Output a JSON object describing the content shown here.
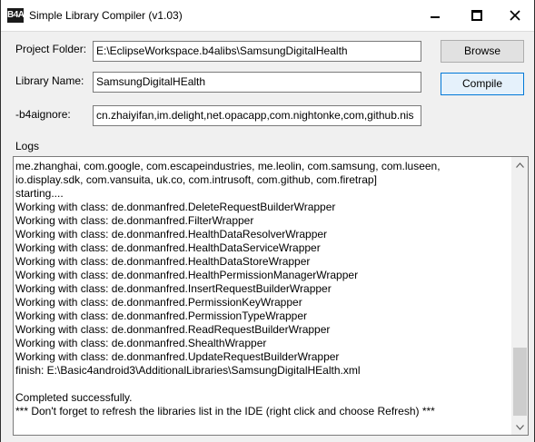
{
  "window": {
    "app_icon": "B4A",
    "title": "Simple Library Compiler (v1.03)",
    "controls": {
      "minimize_icon": "minimize-icon",
      "maximize_icon": "maximize-icon",
      "close_icon": "close-icon"
    }
  },
  "form": {
    "project_folder_label": "Project Folder:",
    "project_folder_value": "E:\\EclipseWorkspace.b4alibs\\SamsungDigitalHealth",
    "library_name_label": "Library Name:",
    "library_name_value": "SamsungDigitalHEalth",
    "b4aignore_label": "-b4aignore:",
    "b4aignore_value": "cn.zhaiyifan,im.delight,net.opacapp,com.nightonke,com,github.nis",
    "browse_label": "Browse",
    "compile_label": "Compile"
  },
  "logs": {
    "label": "Logs",
    "lines": [
      "me.zhanghai, com.google, com.escapeindustries, me.leolin, com.samsung, com.luseen,",
      "io.display.sdk, com.vansuita, uk.co, com.intrusoft, com.github, com.firetrap]",
      "starting....",
      "Working with class: de.donmanfred.DeleteRequestBuilderWrapper",
      "Working with class: de.donmanfred.FilterWrapper",
      "Working with class: de.donmanfred.HealthDataResolverWrapper",
      "Working with class: de.donmanfred.HealthDataServiceWrapper",
      "Working with class: de.donmanfred.HealthDataStoreWrapper",
      "Working with class: de.donmanfred.HealthPermissionManagerWrapper",
      "Working with class: de.donmanfred.InsertRequestBuilderWrapper",
      "Working with class: de.donmanfred.PermissionKeyWrapper",
      "Working with class: de.donmanfred.PermissionTypeWrapper",
      "Working with class: de.donmanfred.ReadRequestBuilderWrapper",
      "Working with class: de.donmanfred.ShealthWrapper",
      "Working with class: de.donmanfred.UpdateRequestBuilderWrapper",
      "finish: E:\\Basic4android3\\AdditionalLibraries\\SamsungDigitalHEalth.xml",
      "",
      "Completed successfully.",
      "*** Don't forget to refresh the libraries list in the IDE (right click and choose Refresh) ***"
    ]
  },
  "colors": {
    "window_bg": "#f0f0f0",
    "default_button_border": "#0078d7",
    "close_hover": "#e81123"
  }
}
